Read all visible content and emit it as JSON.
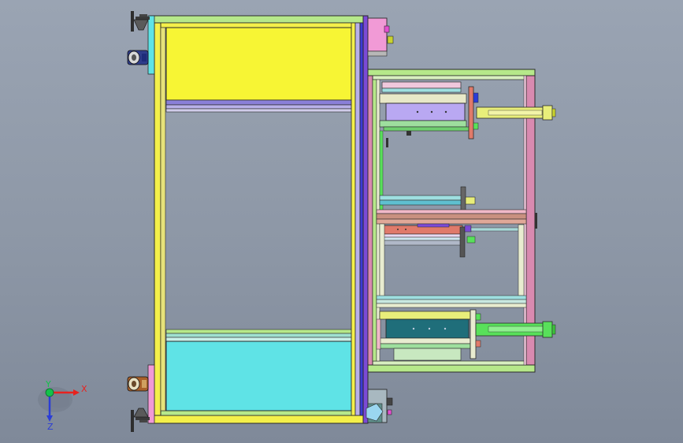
{
  "viewport": {
    "background_top": "#9aa4b3",
    "background_bottom": "#7f8999"
  },
  "colors": {
    "frame_yellow": "#f4f04a",
    "frame_outline": "#2a2a2a",
    "panel_yellow": "#f7f534",
    "panel_cyan": "#5fe3e6",
    "rail_blue": "#3b3bd6",
    "rail_purple": "#7b4ad6",
    "rail_green": "#9edf9e",
    "rail_pink": "#d98ab0",
    "rail_salmon": "#e07a6a",
    "cylinder_lilac": "#b9a8f2",
    "cylinder_teal": "#1f6e7a",
    "rod_yellow": "#e8ee7a",
    "rod_green": "#58e05a",
    "block_magenta": "#e44fd0",
    "block_pink": "#f19ad6",
    "block_teal": "#4f9f9a",
    "tan": "#c9b27a",
    "axis_x": "#e8221e",
    "axis_y": "#13c24a",
    "axis_z": "#2b3dd6"
  },
  "icons": {
    "triad": "xyz-triad-icon",
    "foot": "leveling-foot-icon",
    "caster": "caster-wheel-icon"
  },
  "triad": {
    "x_label": "X",
    "y_label": "Y",
    "z_label": "Z"
  }
}
